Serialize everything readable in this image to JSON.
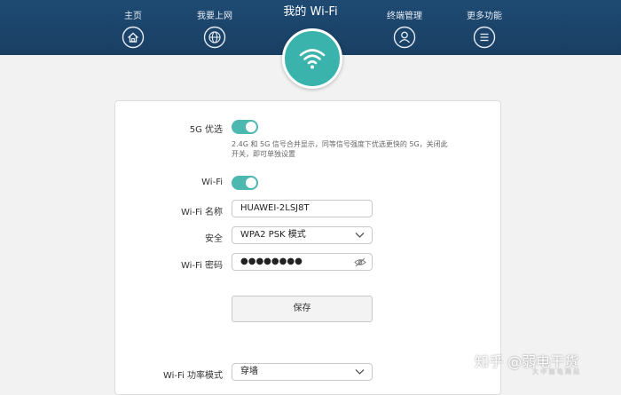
{
  "nav": {
    "home": "主页",
    "internet": "我要上网",
    "wifi": "我的 Wi-Fi",
    "devices": "终端管理",
    "more": "更多功能"
  },
  "settings": {
    "fiveg_label": "5G 优选",
    "fiveg_on": true,
    "fiveg_hint": "2.4G 和 5G 信号合并显示，同等信号强度下优选更快的 5G，关闭此开关，即可单独设置",
    "wifi_label": "Wi-Fi",
    "wifi_on": true,
    "name_label": "Wi-Fi 名称",
    "name_value": "HUAWEI-2LSJ8T",
    "security_label": "安全",
    "security_value": "WPA2 PSK 模式",
    "password_label": "Wi-Fi 密码",
    "password_value": "●●●●●●●●",
    "save_label": "保存",
    "power_label": "Wi-Fi 功率模式",
    "power_value": "穿墙"
  },
  "watermark": {
    "text": "知乎 @弱电干货",
    "sub": "大 中 弱 电 网 站"
  },
  "colors": {
    "topbar": "#1e4a72",
    "accent": "#4db8b0"
  },
  "icons": {
    "home": "home-icon",
    "internet": "globe-icon",
    "wifi": "wifi-icon",
    "devices": "user-icon",
    "more": "menu-icon",
    "select": "chevron-down-icon",
    "password": "eye-off-icon"
  }
}
